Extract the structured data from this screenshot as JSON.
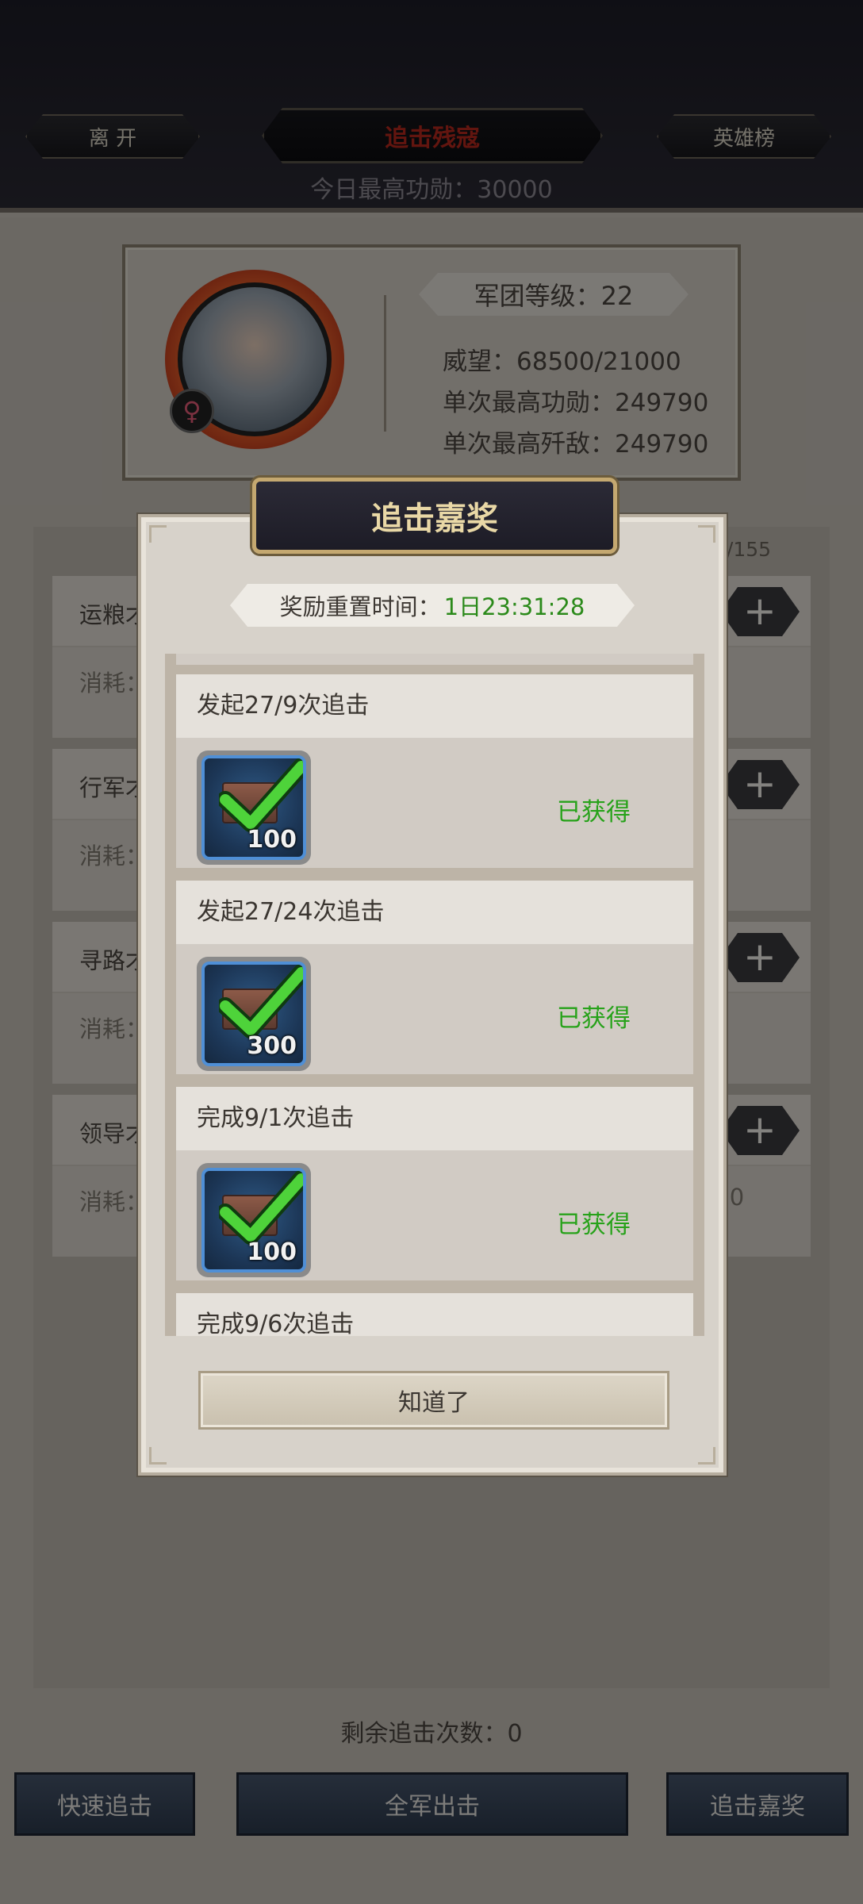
{
  "header": {
    "leave_label": "离 开",
    "title_tab": "追击残寇",
    "heroes_label": "英雄榜",
    "today_merit": "今日最高功勋：30000"
  },
  "profile": {
    "gender_symbol": "♀",
    "level": "军团等级：22",
    "prestige": "威望：68500/21000",
    "max_merit": "单次最高功勋：249790",
    "max_kills": "单次最高歼敌：249790"
  },
  "background": {
    "count_partial": "0/155",
    "rows": [
      {
        "name": "运粮才",
        "cost": "消耗："
      },
      {
        "name": "行军才",
        "cost": "消耗："
      },
      {
        "name": "寻路才",
        "cost": "消耗："
      },
      {
        "name": "领导才",
        "cost": "消耗："
      }
    ],
    "row_trail": ":0",
    "plus_label": "+"
  },
  "footer": {
    "remaining": "剩余追击次数：0",
    "quick_label": "快速追击",
    "all_label": "全军出击",
    "rewards_label": "追击嘉奖"
  },
  "modal": {
    "title": "追击嘉奖",
    "reset_label": "奖励重置时间：",
    "reset_time": "1日23:31:28",
    "items": [
      {
        "title": "发起27/9次追击",
        "qty": "100",
        "status": "已获得"
      },
      {
        "title": "发起27/24次追击",
        "qty": "300",
        "status": "已获得"
      },
      {
        "title": "完成9/1次追击",
        "qty": "100",
        "status": "已获得"
      },
      {
        "title": "完成9/6次追击"
      }
    ],
    "ok_label": "知道了",
    "colors": {
      "claimed": "#27a21a",
      "title_gold": "#e9d8a6",
      "timer_green": "#2b8a1a"
    }
  }
}
